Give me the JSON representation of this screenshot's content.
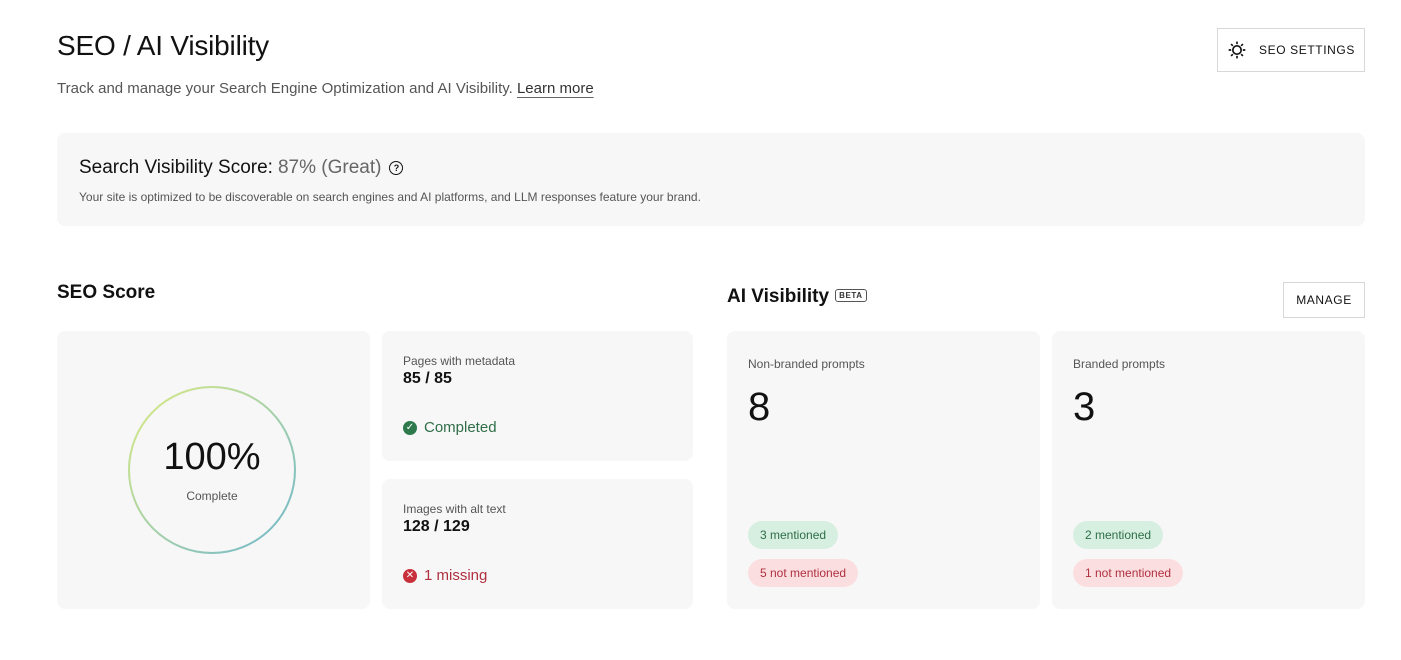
{
  "header": {
    "title": "SEO / AI Visibility",
    "subtitle": "Track and manage your Search Engine Optimization and AI Visibility.",
    "learn_more": "Learn more",
    "settings_label": "SEO SETTINGS"
  },
  "visibility_score": {
    "title": "Search Visibility Score:",
    "value": "87% (Great)",
    "help_icon": "question-circle-icon",
    "description": "Your site is optimized to be discoverable on search engines and AI platforms, and LLM responses feature your brand."
  },
  "seo": {
    "heading": "SEO Score",
    "score_percent": "100%",
    "score_fraction": 1.0,
    "score_label": "Complete",
    "metadata": {
      "label": "Pages with metadata",
      "value": "85 / 85",
      "status": "Completed",
      "status_icon": "check-circle-icon"
    },
    "alt_text": {
      "label": "Images with alt text",
      "value": "128 / 129",
      "status": "1 missing",
      "status_icon": "x-circle-icon"
    }
  },
  "ai": {
    "heading": "AI Visibility",
    "badge": "BETA",
    "manage_label": "MANAGE",
    "non_branded": {
      "label": "Non-branded prompts",
      "count": "8",
      "mentioned": "3 mentioned",
      "not_mentioned": "5 not mentioned"
    },
    "branded": {
      "label": "Branded prompts",
      "count": "3",
      "mentioned": "2 mentioned",
      "not_mentioned": "1 not mentioned"
    }
  },
  "colors": {
    "success": "#2f7a4d",
    "error": "#c8303c",
    "pill_green_bg": "#d6efe0",
    "pill_red_bg": "#fbdfe0",
    "ring_start": "#6fb7cf",
    "ring_end": "#dcec82"
  }
}
